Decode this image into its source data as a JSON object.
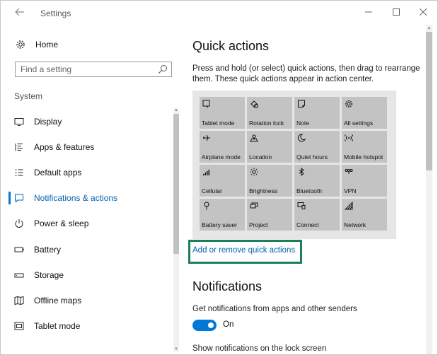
{
  "window": {
    "title": "Settings",
    "back_icon": "back-arrow-icon",
    "minimize_glyph": "—",
    "maximize_glyph": "☐",
    "close_glyph": "✕"
  },
  "sidebar": {
    "home_label": "Home",
    "search_placeholder": "Find a setting",
    "section_label": "System",
    "items": [
      {
        "label": "Display",
        "icon": "display-icon"
      },
      {
        "label": "Apps & features",
        "icon": "apps-features-icon"
      },
      {
        "label": "Default apps",
        "icon": "default-apps-icon"
      },
      {
        "label": "Notifications & actions",
        "icon": "notifications-icon",
        "active": true
      },
      {
        "label": "Power & sleep",
        "icon": "power-icon"
      },
      {
        "label": "Battery",
        "icon": "battery-icon"
      },
      {
        "label": "Storage",
        "icon": "storage-icon"
      },
      {
        "label": "Offline maps",
        "icon": "map-icon"
      },
      {
        "label": "Tablet mode",
        "icon": "tablet-icon"
      }
    ]
  },
  "main": {
    "title": "Quick actions",
    "description": "Press and hold (or select) quick actions, then drag to rearrange them. These quick actions appear in action center.",
    "tiles": [
      {
        "label": "Tablet mode",
        "icon": "tablet-mode-icon"
      },
      {
        "label": "Rotation lock",
        "icon": "rotation-lock-icon"
      },
      {
        "label": "Note",
        "icon": "note-icon"
      },
      {
        "label": "All settings",
        "icon": "gear-icon"
      },
      {
        "label": "Airplane mode",
        "icon": "airplane-icon"
      },
      {
        "label": "Location",
        "icon": "location-icon"
      },
      {
        "label": "Quiet hours",
        "icon": "moon-icon"
      },
      {
        "label": "Mobile hotspot",
        "icon": "hotspot-icon"
      },
      {
        "label": "Cellular",
        "icon": "cellular-icon"
      },
      {
        "label": "Brightness",
        "icon": "brightness-icon"
      },
      {
        "label": "Bluetooth",
        "icon": "bluetooth-icon"
      },
      {
        "label": "VPN",
        "icon": "vpn-icon"
      },
      {
        "label": "Battery saver",
        "icon": "battery-saver-icon"
      },
      {
        "label": "Project",
        "icon": "project-icon"
      },
      {
        "label": "Connect",
        "icon": "connect-icon"
      },
      {
        "label": "Network",
        "icon": "network-icon"
      }
    ],
    "link_label": "Add or remove quick actions",
    "notifications_title": "Notifications",
    "notifications_desc": "Get notifications from apps and other senders",
    "toggle_label": "On",
    "toggle_on": true,
    "cutoff_text": "Show notifications on the lock screen"
  },
  "colors": {
    "accent": "#0078d7",
    "link": "#0063b1",
    "highlight_border": "#1a7f5a",
    "tile_bg": "#c3c3c3",
    "panel_bg": "#e6e6e6"
  }
}
